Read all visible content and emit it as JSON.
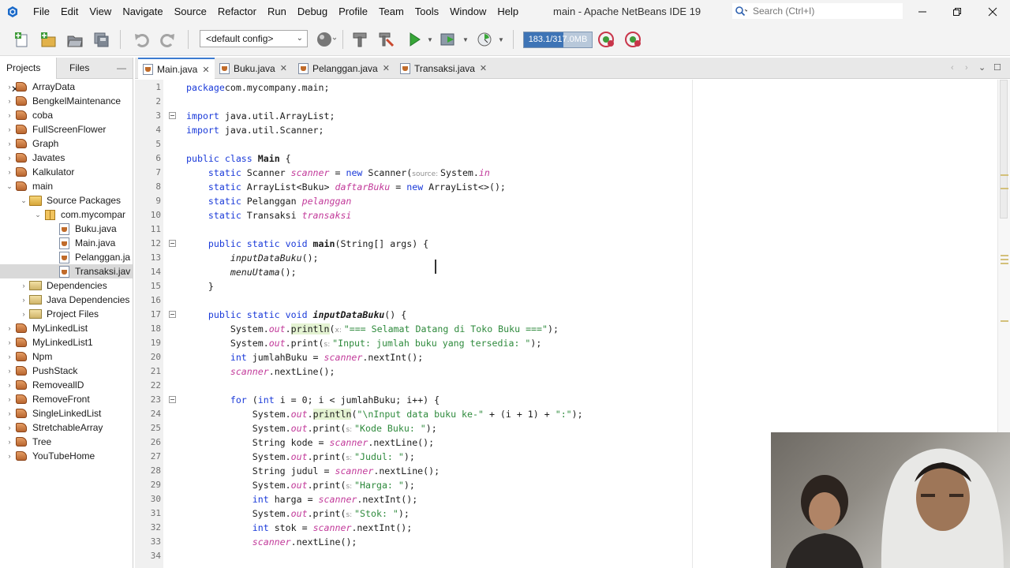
{
  "titlebar": {
    "menus": [
      "File",
      "Edit",
      "View",
      "Navigate",
      "Source",
      "Refactor",
      "Run",
      "Debug",
      "Profile",
      "Team",
      "Tools",
      "Window",
      "Help"
    ],
    "window_title": "main - Apache NetBeans IDE 19",
    "search_placeholder": "Search (Ctrl+I)"
  },
  "toolbar": {
    "config": "<default config>",
    "memory": "183.1/317.0MB",
    "memory_fraction": 0.58
  },
  "left_panel": {
    "tabs": [
      "Projects",
      "Files"
    ],
    "tree": [
      {
        "label": "ArrayData",
        "icon": "project-icon",
        "level": 0,
        "toggle": "›"
      },
      {
        "label": "BengkelMaintenance",
        "icon": "project-icon",
        "level": 0,
        "toggle": "›"
      },
      {
        "label": "coba",
        "icon": "project-icon",
        "level": 0,
        "toggle": "›"
      },
      {
        "label": "FullScreenFlower",
        "icon": "project-icon",
        "level": 0,
        "toggle": "›"
      },
      {
        "label": "Graph",
        "icon": "project-icon",
        "level": 0,
        "toggle": "›"
      },
      {
        "label": "Javates",
        "icon": "project-icon",
        "level": 0,
        "toggle": "›"
      },
      {
        "label": "Kalkulator",
        "icon": "project-icon",
        "level": 0,
        "toggle": "›"
      },
      {
        "label": "main",
        "icon": "project-icon",
        "level": 0,
        "toggle": "⌄"
      },
      {
        "label": "Source Packages",
        "icon": "source-packages-icon",
        "level": 1,
        "toggle": "⌄"
      },
      {
        "label": "com.mycompar",
        "icon": "package-icon",
        "level": 2,
        "toggle": "⌄"
      },
      {
        "label": "Buku.java",
        "icon": "java-file-icon",
        "level": 3,
        "toggle": ""
      },
      {
        "label": "Main.java",
        "icon": "java-file-icon",
        "level": 3,
        "toggle": ""
      },
      {
        "label": "Pelanggan.ja",
        "icon": "java-file-icon",
        "level": 3,
        "toggle": ""
      },
      {
        "label": "Transaksi.jav",
        "icon": "java-file-icon",
        "level": 3,
        "toggle": "",
        "selected": true
      },
      {
        "label": "Dependencies",
        "icon": "libraries-icon",
        "level": 1,
        "toggle": "›"
      },
      {
        "label": "Java Dependencies",
        "icon": "libraries-icon",
        "level": 1,
        "toggle": "›"
      },
      {
        "label": "Project Files",
        "icon": "libraries-icon",
        "level": 1,
        "toggle": "›"
      },
      {
        "label": "MyLinkedList",
        "icon": "project-icon",
        "level": 0,
        "toggle": "›"
      },
      {
        "label": "MyLinkedList1",
        "icon": "project-icon",
        "level": 0,
        "toggle": "›"
      },
      {
        "label": "Npm",
        "icon": "project-icon",
        "level": 0,
        "toggle": "›"
      },
      {
        "label": "PushStack",
        "icon": "project-icon",
        "level": 0,
        "toggle": "›"
      },
      {
        "label": "RemoveallD",
        "icon": "project-icon",
        "level": 0,
        "toggle": "›"
      },
      {
        "label": "RemoveFront",
        "icon": "project-icon",
        "level": 0,
        "toggle": "›"
      },
      {
        "label": "SingleLinkedList",
        "icon": "project-icon",
        "level": 0,
        "toggle": "›"
      },
      {
        "label": "StretchableArray",
        "icon": "project-icon",
        "level": 0,
        "toggle": "›"
      },
      {
        "label": "Tree",
        "icon": "project-icon",
        "level": 0,
        "toggle": "›"
      },
      {
        "label": "YouTubeHome",
        "icon": "project-icon",
        "level": 0,
        "toggle": "›"
      }
    ]
  },
  "editor_tabs": [
    {
      "label": "Main.java",
      "active": true
    },
    {
      "label": "Buku.java",
      "active": false
    },
    {
      "label": "Pelanggan.java",
      "active": false
    },
    {
      "label": "Transaksi.java",
      "active": false
    }
  ],
  "code_lines": [
    {
      "n": "1",
      "fold": false,
      "tokens": [
        [
          "kw",
          "package"
        ],
        [
          "",
          "com.mycompany.main;"
        ]
      ]
    },
    {
      "n": "2",
      "fold": false,
      "tokens": []
    },
    {
      "n": "3",
      "fold": true,
      "tokens": [
        [
          "kw",
          "import"
        ],
        [
          "",
          " java.util.ArrayList;"
        ]
      ]
    },
    {
      "n": "4",
      "fold": false,
      "tokens": [
        [
          "kw",
          "import"
        ],
        [
          "",
          " java.util.Scanner;"
        ]
      ]
    },
    {
      "n": "5",
      "fold": false,
      "tokens": []
    },
    {
      "n": "6",
      "fold": false,
      "tokens": [
        [
          "kw",
          "public class"
        ],
        [
          "",
          " "
        ],
        [
          "bold",
          "Main"
        ],
        [
          "",
          " {"
        ]
      ]
    },
    {
      "n": "7",
      "fold": false,
      "tokens": [
        [
          "",
          "    "
        ],
        [
          "kw",
          "static"
        ],
        [
          "",
          " Scanner "
        ],
        [
          "fld",
          "scanner"
        ],
        [
          "",
          " = "
        ],
        [
          "kw",
          "new"
        ],
        [
          "",
          " Scanner("
        ],
        [
          "hint",
          "source: "
        ],
        [
          "",
          "System."
        ],
        [
          "fld",
          "in"
        ],
        [
          ");"
        ]
      ]
    },
    {
      "n": "8",
      "fold": false,
      "tokens": [
        [
          "",
          "    "
        ],
        [
          "kw",
          "static"
        ],
        [
          "",
          " ArrayList<Buku> "
        ],
        [
          "fld",
          "daftarBuku"
        ],
        [
          "",
          " = "
        ],
        [
          "kw",
          "new"
        ],
        [
          "",
          " ArrayList<>();"
        ]
      ]
    },
    {
      "n": "9",
      "fold": false,
      "tokens": [
        [
          "",
          "    "
        ],
        [
          "kw",
          "static"
        ],
        [
          "",
          " Pelanggan "
        ],
        [
          "fld",
          "pelanggan"
        ],
        [
          ";"
        ]
      ]
    },
    {
      "n": "10",
      "fold": false,
      "tokens": [
        [
          "",
          "    "
        ],
        [
          "kw",
          "static"
        ],
        [
          "",
          " Transaksi "
        ],
        [
          "fld",
          "transaksi"
        ],
        [
          ";"
        ]
      ]
    },
    {
      "n": "11",
      "fold": false,
      "tokens": []
    },
    {
      "n": "12",
      "fold": true,
      "tokens": [
        [
          "",
          "    "
        ],
        [
          "kw",
          "public static void"
        ],
        [
          "",
          " "
        ],
        [
          "bold",
          "main"
        ],
        [
          "",
          "(String[] args) {"
        ]
      ]
    },
    {
      "n": "13",
      "fold": false,
      "tokens": [
        [
          "",
          "        "
        ],
        [
          "call-it",
          "inputDataBuku"
        ],
        [
          "",
          "();"
        ]
      ]
    },
    {
      "n": "14",
      "fold": false,
      "tokens": [
        [
          "",
          "        "
        ],
        [
          "call-it",
          "menuUtama"
        ],
        [
          "",
          "();"
        ]
      ]
    },
    {
      "n": "15",
      "fold": false,
      "tokens": [
        [
          "",
          "    }"
        ]
      ]
    },
    {
      "n": "16",
      "fold": false,
      "tokens": []
    },
    {
      "n": "17",
      "fold": true,
      "tokens": [
        [
          "",
          "    "
        ],
        [
          "kw",
          "public static void"
        ],
        [
          "",
          " "
        ],
        [
          "it-bold",
          "inputDataBuku"
        ],
        [
          "",
          "() {"
        ]
      ]
    },
    {
      "n": "18",
      "fold": false,
      "tokens": [
        [
          "",
          "        System."
        ],
        [
          "fld",
          "out"
        ],
        [
          "",
          "."
        ],
        [
          "hl",
          "println"
        ],
        [
          "",
          "("
        ],
        [
          "hint",
          "x: "
        ],
        [
          "st",
          "\"=== Selamat Datang di Toko Buku ===\""
        ],
        [
          "",
          ");"
        ]
      ]
    },
    {
      "n": "19",
      "fold": false,
      "tokens": [
        [
          "",
          "        System."
        ],
        [
          "fld",
          "out"
        ],
        [
          "",
          ".print("
        ],
        [
          "hint",
          "s: "
        ],
        [
          "st",
          "\"Input: jumlah buku yang tersedia: \""
        ],
        [
          "",
          ");"
        ]
      ]
    },
    {
      "n": "20",
      "fold": false,
      "tokens": [
        [
          "",
          "        "
        ],
        [
          "kw",
          "int"
        ],
        [
          "",
          " jumlahBuku = "
        ],
        [
          "fld",
          "scanner"
        ],
        [
          "",
          ".nextInt();"
        ]
      ]
    },
    {
      "n": "21",
      "fold": false,
      "tokens": [
        [
          "",
          "        "
        ],
        [
          "fld",
          "scanner"
        ],
        [
          "",
          ".nextLine();"
        ]
      ]
    },
    {
      "n": "22",
      "fold": false,
      "tokens": []
    },
    {
      "n": "23",
      "fold": true,
      "tokens": [
        [
          "",
          "        "
        ],
        [
          "kw",
          "for"
        ],
        [
          "",
          " ("
        ],
        [
          "kw",
          "int"
        ],
        [
          "",
          " i = 0; i < jumlahBuku; i++) {"
        ]
      ]
    },
    {
      "n": "24",
      "fold": false,
      "tokens": [
        [
          "",
          "            System."
        ],
        [
          "fld",
          "out"
        ],
        [
          "",
          "."
        ],
        [
          "hl",
          "println"
        ],
        [
          "",
          "("
        ],
        [
          "st",
          "\"\\nInput data buku ke-\""
        ],
        [
          "",
          " + (i + 1) + "
        ],
        [
          "st",
          "\":\""
        ],
        [
          "",
          ");"
        ]
      ]
    },
    {
      "n": "25",
      "fold": false,
      "tokens": [
        [
          "",
          "            System."
        ],
        [
          "fld",
          "out"
        ],
        [
          "",
          ".print("
        ],
        [
          "hint",
          "s: "
        ],
        [
          "st",
          "\"Kode Buku: \""
        ],
        [
          "",
          ");"
        ]
      ]
    },
    {
      "n": "26",
      "fold": false,
      "tokens": [
        [
          "",
          "            String kode = "
        ],
        [
          "fld",
          "scanner"
        ],
        [
          "",
          ".nextLine();"
        ]
      ]
    },
    {
      "n": "27",
      "fold": false,
      "tokens": [
        [
          "",
          "            System."
        ],
        [
          "fld",
          "out"
        ],
        [
          "",
          ".print("
        ],
        [
          "hint",
          "s: "
        ],
        [
          "st",
          "\"Judul: \""
        ],
        [
          "",
          ");"
        ]
      ]
    },
    {
      "n": "28",
      "fold": false,
      "tokens": [
        [
          "",
          "            String judul = "
        ],
        [
          "fld",
          "scanner"
        ],
        [
          "",
          ".nextLine();"
        ]
      ]
    },
    {
      "n": "29",
      "fold": false,
      "tokens": [
        [
          "",
          "            System."
        ],
        [
          "fld",
          "out"
        ],
        [
          "",
          ".print("
        ],
        [
          "hint",
          "s: "
        ],
        [
          "st",
          "\"Harga: \""
        ],
        [
          "",
          ");"
        ]
      ]
    },
    {
      "n": "30",
      "fold": false,
      "tokens": [
        [
          "",
          "            "
        ],
        [
          "kw",
          "int"
        ],
        [
          "",
          " harga = "
        ],
        [
          "fld",
          "scanner"
        ],
        [
          "",
          ".nextInt();"
        ]
      ]
    },
    {
      "n": "31",
      "fold": false,
      "tokens": [
        [
          "",
          "            System."
        ],
        [
          "fld",
          "out"
        ],
        [
          "",
          ".print("
        ],
        [
          "hint",
          "s: "
        ],
        [
          "st",
          "\"Stok: \""
        ],
        [
          "",
          ");"
        ]
      ]
    },
    {
      "n": "32",
      "fold": false,
      "tokens": [
        [
          "",
          "            "
        ],
        [
          "kw",
          "int"
        ],
        [
          "",
          " stok = "
        ],
        [
          "fld",
          "scanner"
        ],
        [
          "",
          ".nextInt();"
        ]
      ]
    },
    {
      "n": "33",
      "fold": false,
      "tokens": [
        [
          "",
          "            "
        ],
        [
          "fld",
          "scanner"
        ],
        [
          "",
          ".nextLine();"
        ]
      ]
    },
    {
      "n": "34",
      "fold": false,
      "tokens": []
    }
  ],
  "colors": {
    "keyword": "#1a3ad9",
    "field": "#c23a9a",
    "string": "#2e8a3c",
    "active_tab_accent": "#3d7bd0"
  }
}
